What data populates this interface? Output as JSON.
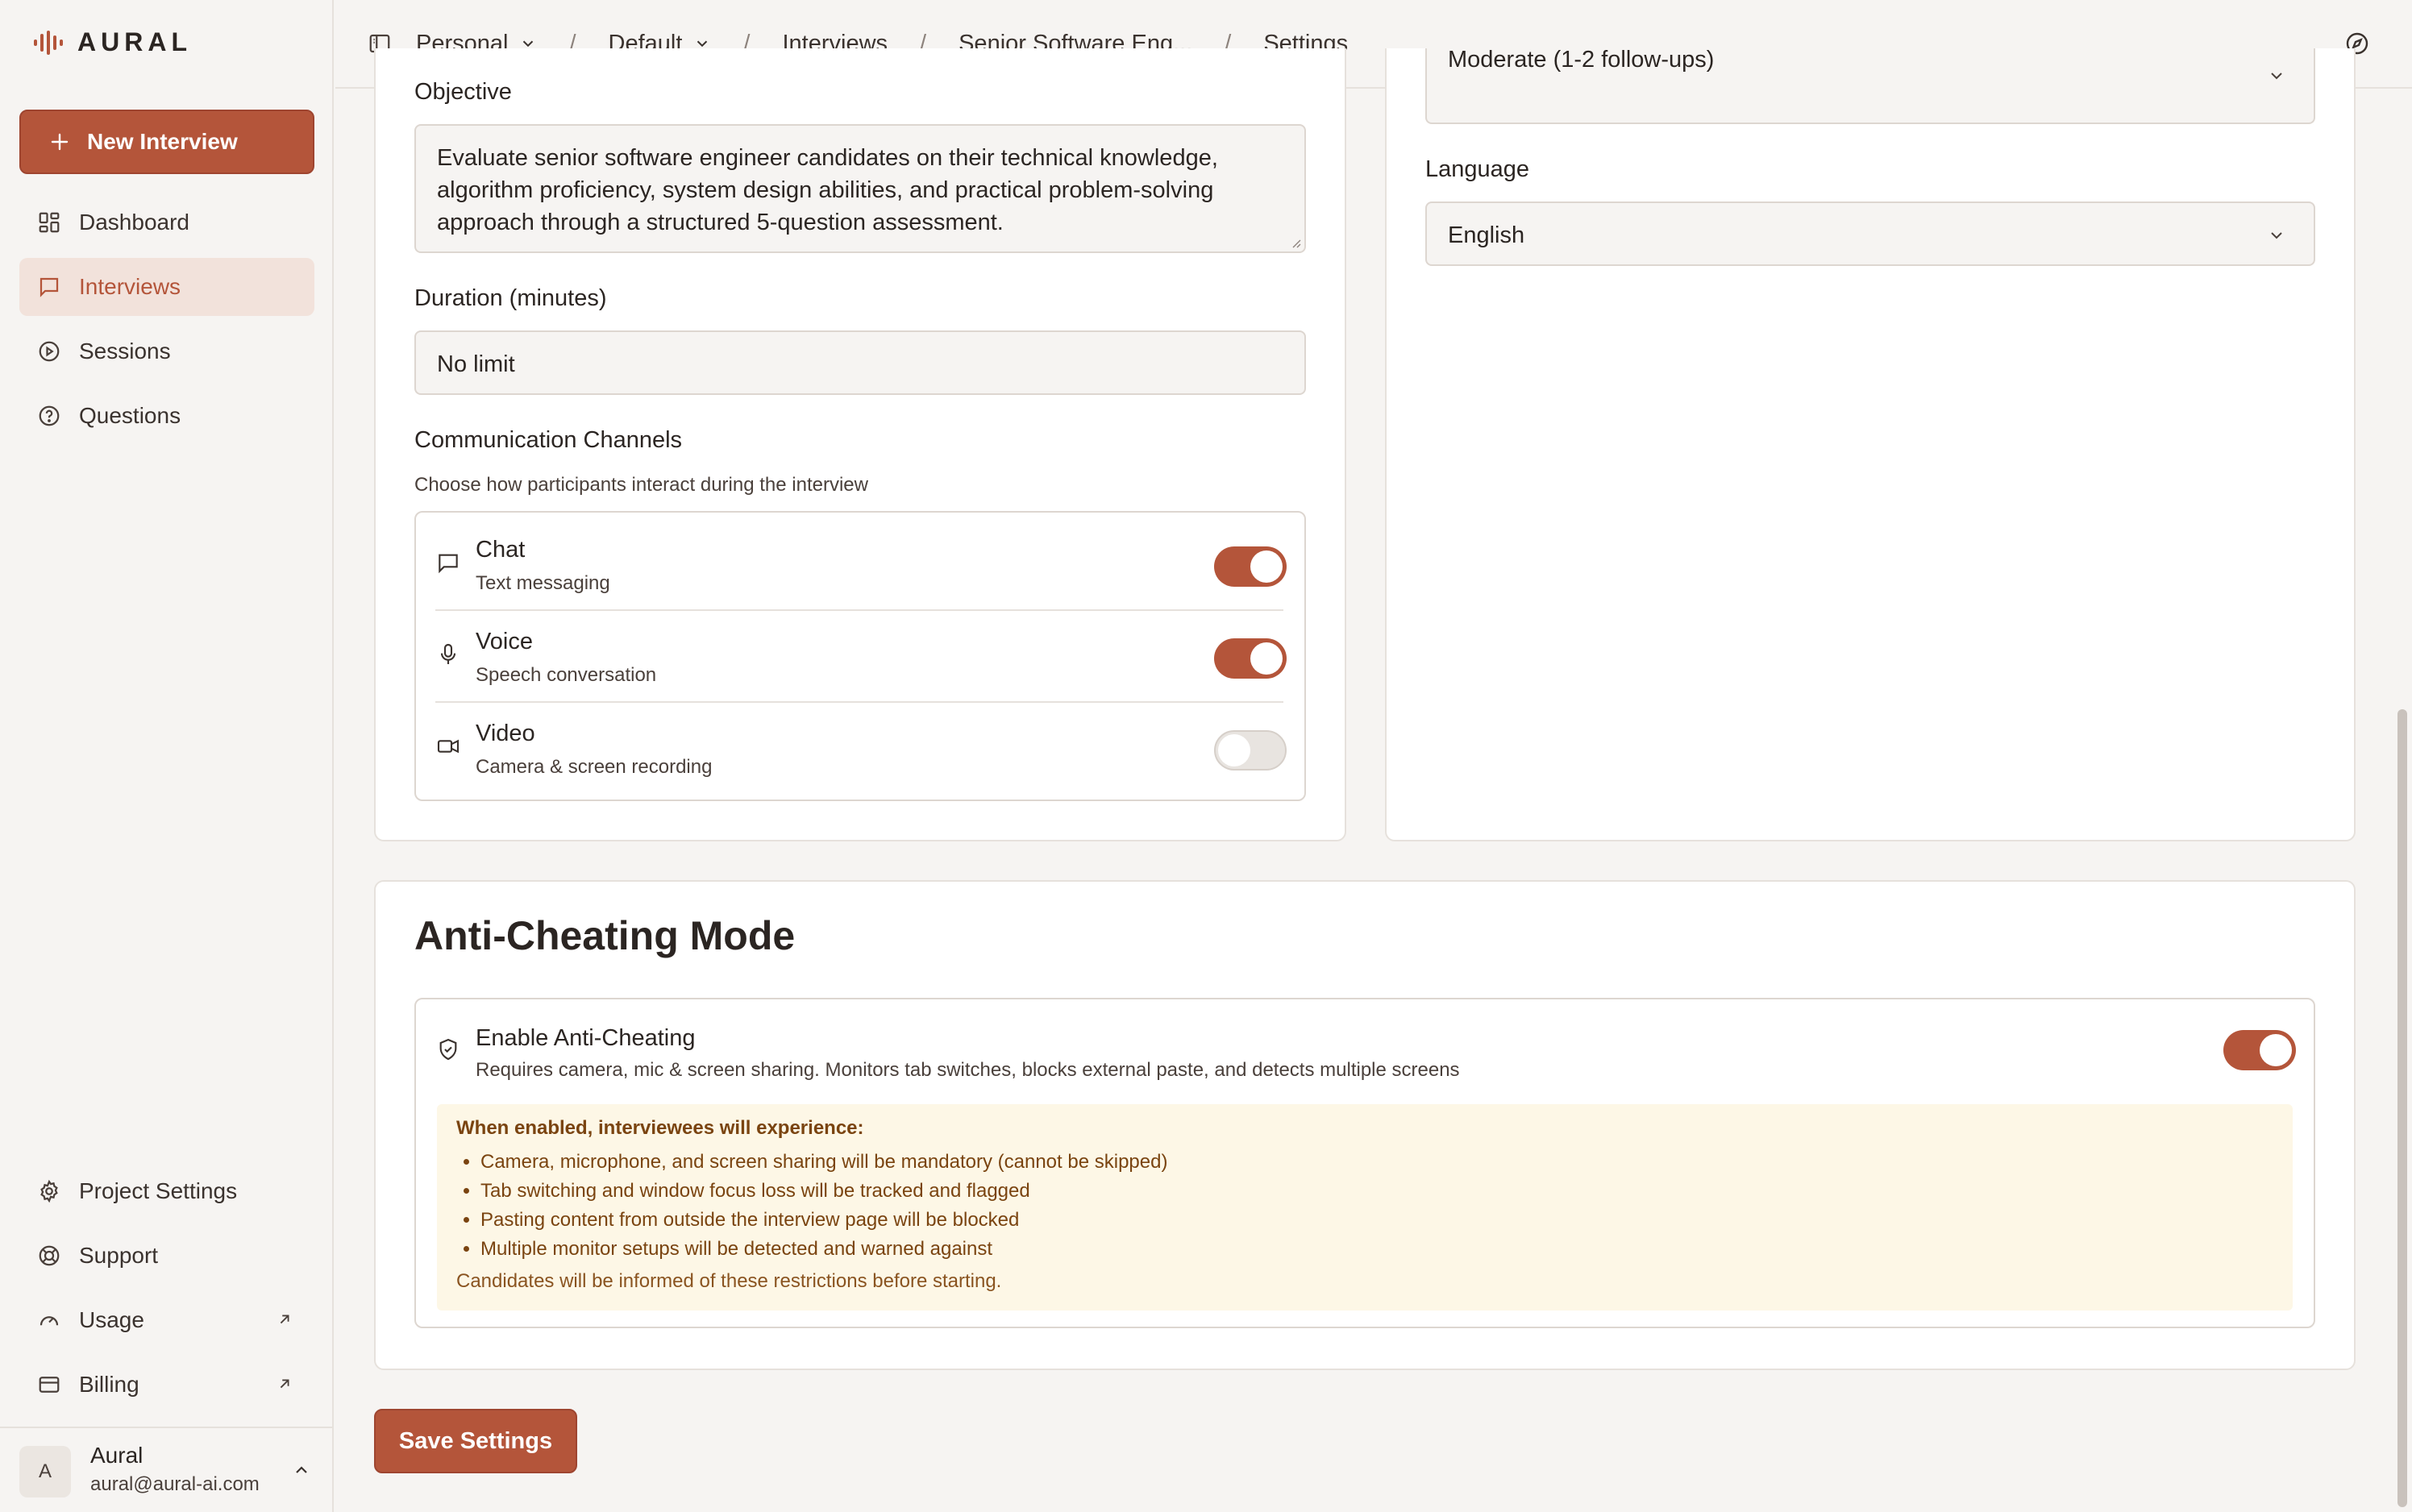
{
  "app": {
    "brand": "AURAL",
    "accent_color": "#b4553a"
  },
  "sidebar": {
    "new_interview": "New Interview",
    "items": [
      {
        "label": "Dashboard",
        "icon": "dashboard-icon"
      },
      {
        "label": "Interviews",
        "icon": "message-square-icon",
        "active": true
      },
      {
        "label": "Sessions",
        "icon": "play-circle-icon"
      },
      {
        "label": "Questions",
        "icon": "help-circle-icon"
      }
    ],
    "bottom_items": [
      {
        "label": "Project Settings",
        "icon": "gear-icon"
      },
      {
        "label": "Support",
        "icon": "lifebuoy-icon"
      },
      {
        "label": "Usage",
        "icon": "gauge-icon",
        "external": true
      },
      {
        "label": "Billing",
        "icon": "credit-card-icon",
        "external": true
      }
    ],
    "user": {
      "initial": "A",
      "name": "Aural",
      "email": "aural@aural-ai.com"
    }
  },
  "breadcrumb": {
    "workspace": "Personal",
    "project": "Default",
    "section": "Interviews",
    "interview": "Senior Software Eng...",
    "page": "Settings"
  },
  "form": {
    "objective_label": "Objective",
    "objective_value": "Evaluate senior software engineer candidates on their technical knowledge, algorithm proficiency, system design abilities, and practical problem-solving approach through a structured 5-question assessment.",
    "duration_label": "Duration (minutes)",
    "duration_value": "No limit",
    "followup_value": "Moderate (1-2 follow-ups)",
    "language_label": "Language",
    "language_value": "English",
    "channels_label": "Communication Channels",
    "channels_hint": "Choose how participants interact during the interview",
    "channels": [
      {
        "title": "Chat",
        "sub": "Text messaging",
        "icon": "chat-icon",
        "enabled": true
      },
      {
        "title": "Voice",
        "sub": "Speech conversation",
        "icon": "microphone-icon",
        "enabled": true
      },
      {
        "title": "Video",
        "sub": "Camera & screen recording",
        "icon": "video-camera-icon",
        "enabled": false
      }
    ]
  },
  "anti_cheating": {
    "heading": "Anti-Cheating Mode",
    "title": "Enable Anti-Cheating",
    "sub": "Requires camera, mic & screen sharing. Monitors tab switches, blocks external paste, and detects multiple screens",
    "enabled": true,
    "warning_head": "When enabled, interviewees will experience:",
    "bullets": [
      "Camera, microphone, and screen sharing will be mandatory (cannot be skipped)",
      "Tab switching and window focus loss will be tracked and flagged",
      "Pasting content from outside the interview page will be blocked",
      "Multiple monitor setups will be detected and warned against"
    ],
    "warning_foot": "Candidates will be informed of these restrictions before starting."
  },
  "actions": {
    "save": "Save Settings"
  }
}
